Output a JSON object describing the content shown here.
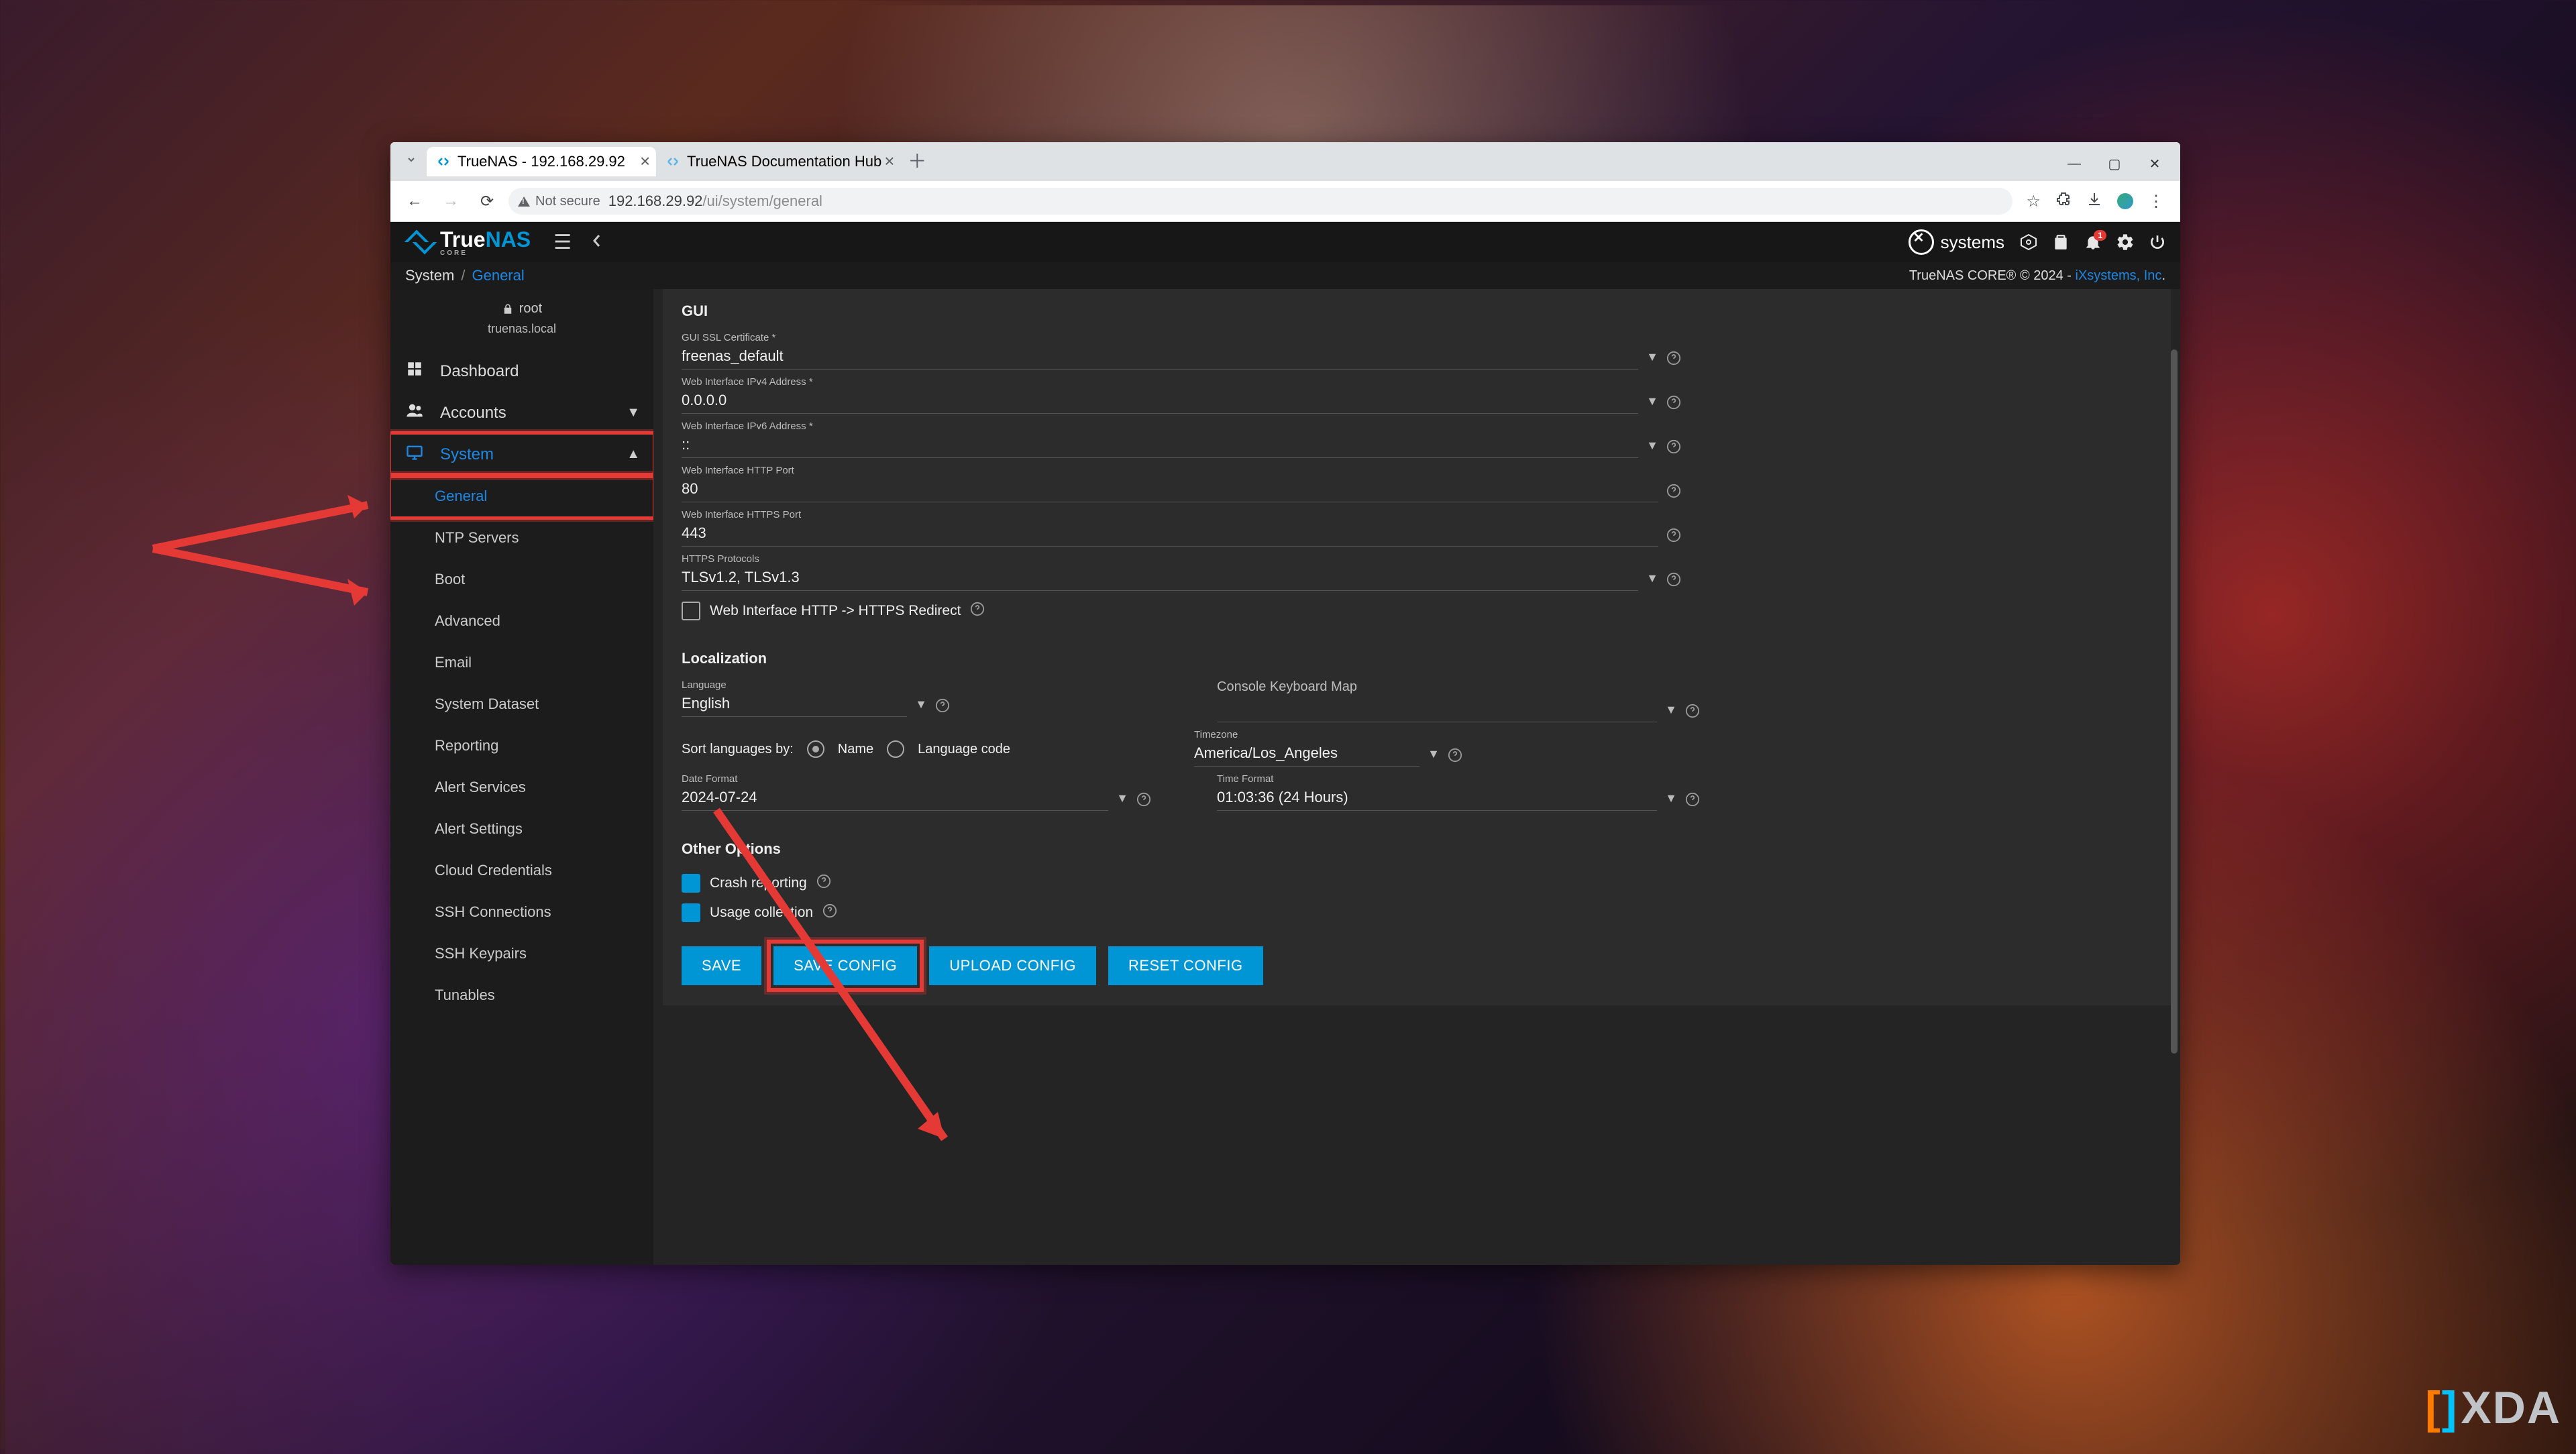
{
  "browser": {
    "tabs": [
      {
        "title": "TrueNAS - 192.168.29.92",
        "active": true
      },
      {
        "title": "TrueNAS Documentation Hub",
        "active": false
      }
    ],
    "security_label": "Not secure",
    "url_host": "192.168.29.92",
    "url_path": "/ui/system/general"
  },
  "topbar": {
    "logo_true": "True",
    "logo_nas": "NAS",
    "logo_sub": "CORE",
    "ix_label": "systems",
    "notif_count": "1"
  },
  "breadcrumb": {
    "root": "System",
    "current": "General",
    "brand_text": "TrueNAS CORE® © 2024 - ",
    "brand_link": "iXsystems, Inc"
  },
  "user": {
    "name": "root",
    "host": "truenas.local"
  },
  "sidebar": {
    "dashboard": "Dashboard",
    "accounts": "Accounts",
    "system": "System",
    "children": {
      "general": "General",
      "ntp": "NTP Servers",
      "boot": "Boot",
      "advanced": "Advanced",
      "email": "Email",
      "sysds": "System Dataset",
      "reporting": "Reporting",
      "alertsvc": "Alert Services",
      "alertset": "Alert Settings",
      "cloud": "Cloud Credentials",
      "sshconn": "SSH Connections",
      "sshkeys": "SSH Keypairs",
      "tunables": "Tunables"
    }
  },
  "form": {
    "gui": {
      "title": "GUI",
      "cert_label": "GUI SSL Certificate *",
      "cert_value": "freenas_default",
      "ipv4_label": "Web Interface IPv4 Address *",
      "ipv4_value": "0.0.0.0",
      "ipv6_label": "Web Interface IPv6 Address *",
      "ipv6_value": "::",
      "http_label": "Web Interface HTTP Port",
      "http_value": "80",
      "https_label": "Web Interface HTTPS Port",
      "https_value": "443",
      "proto_label": "HTTPS Protocols",
      "proto_value": "TLSv1.2, TLSv1.3",
      "redirect_label": "Web Interface HTTP -> HTTPS Redirect"
    },
    "loc": {
      "title": "Localization",
      "lang_label": "Language",
      "lang_value": "English",
      "kbd_label": "Console Keyboard Map",
      "kbd_value": "",
      "sort_label": "Sort languages by:",
      "sort_name": "Name",
      "sort_code": "Language code",
      "tz_label": "Timezone",
      "tz_value": "America/Los_Angeles",
      "date_label": "Date Format",
      "date_value": "2024-07-24",
      "time_label": "Time Format",
      "time_value": "01:03:36 (24 Hours)"
    },
    "other": {
      "title": "Other Options",
      "crash": "Crash reporting",
      "usage": "Usage collection"
    },
    "buttons": {
      "save": "SAVE",
      "saveconf": "SAVE CONFIG",
      "upload": "UPLOAD CONFIG",
      "reset": "RESET CONFIG"
    }
  },
  "colors": {
    "accent": "#0095d5",
    "alert": "#e53935",
    "link": "#1e88e5"
  }
}
